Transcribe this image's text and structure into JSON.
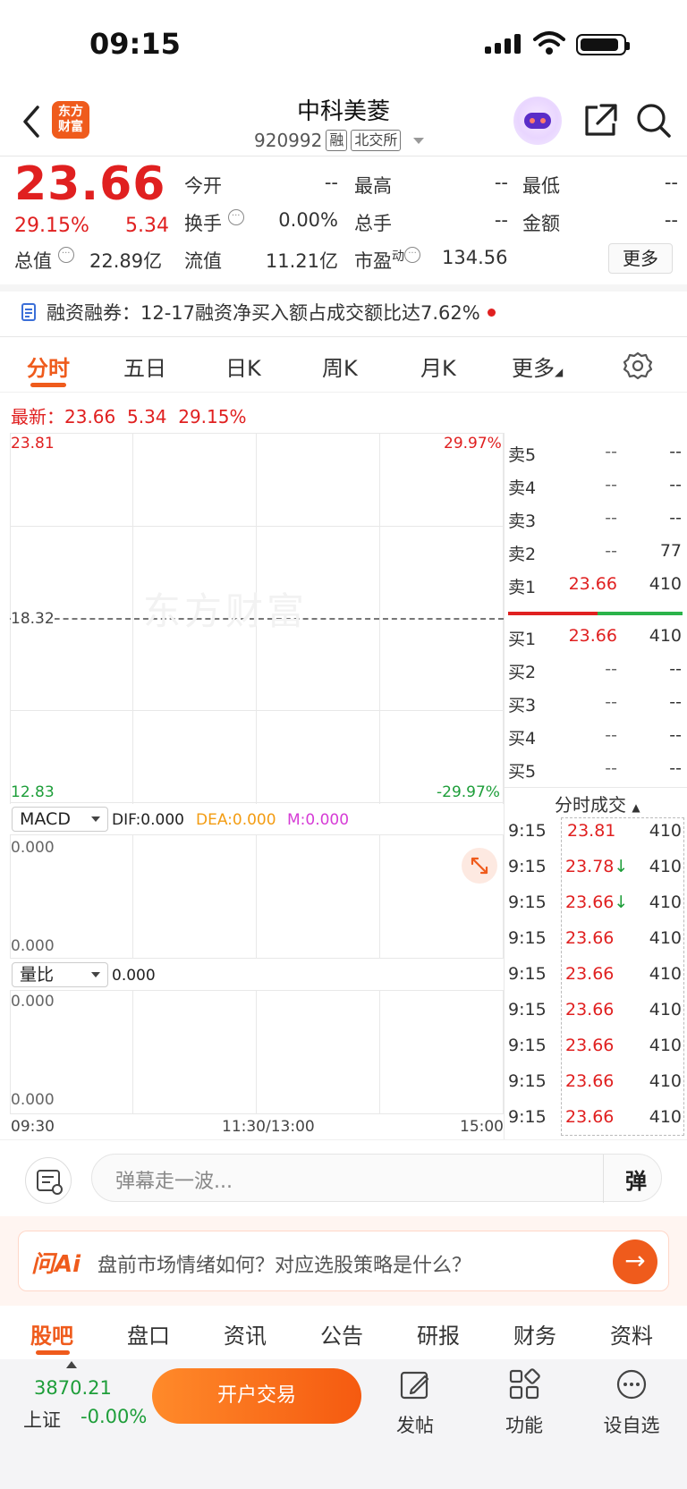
{
  "status": {
    "time": "09:15"
  },
  "header": {
    "logo_line1": "东方",
    "logo_line2": "财富",
    "stock_name": "中科美菱",
    "code": "920992",
    "tag_margin": "融",
    "tag_exchange": "北交所"
  },
  "quote": {
    "price": "23.66",
    "change_pct": "29.15%",
    "change": "5.34",
    "open_label": "今开",
    "open_value": "--",
    "high_label": "最高",
    "high_value": "--",
    "low_label": "最低",
    "low_value": "--",
    "turnover_label": "换手",
    "turnover_value": "0.00%",
    "volume_label": "总手",
    "volume_value": "--",
    "amount_label": "金额",
    "amount_value": "--",
    "mktcap_label": "总值",
    "mktcap_value": "22.89亿",
    "float_label": "流值",
    "float_value": "11.21亿",
    "pe_label": "市盈",
    "pe_sup": "动",
    "pe_value": "134.56",
    "more_label": "更多"
  },
  "notice": {
    "text": "融资融券：12-17融资净买入额占成交额比达7.62%"
  },
  "tabs": [
    "分时",
    "五日",
    "日K",
    "周K",
    "月K",
    "更多"
  ],
  "chart": {
    "latest_label": "最新：",
    "latest_price": "23.66",
    "latest_change": "5.34",
    "latest_pct": "29.15%",
    "y_top": "23.81",
    "y_mid": "18.32",
    "y_bottom": "12.83",
    "pct_top": "29.97%",
    "pct_bottom": "-29.97%",
    "watermark": "东方财富",
    "x_start": "09:30",
    "x_mid": "11:30/13:00",
    "x_end": "15:00"
  },
  "macd": {
    "selector": "MACD",
    "dif": "DIF:0.000",
    "dea": "DEA:0.000",
    "m": "M:0.000",
    "top": "0.000",
    "bottom": "0.000"
  },
  "volume_ratio": {
    "selector": "量比",
    "value": "0.000",
    "top": "0.000",
    "bottom": "0.000"
  },
  "order_book": {
    "asks": [
      {
        "label": "卖5",
        "price": "--",
        "vol": "--"
      },
      {
        "label": "卖4",
        "price": "--",
        "vol": "--"
      },
      {
        "label": "卖3",
        "price": "--",
        "vol": "--"
      },
      {
        "label": "卖2",
        "price": "--",
        "vol": "77"
      },
      {
        "label": "卖1",
        "price": "23.66",
        "vol": "410"
      }
    ],
    "bids": [
      {
        "label": "买1",
        "price": "23.66",
        "vol": "410"
      },
      {
        "label": "买2",
        "price": "--",
        "vol": "--"
      },
      {
        "label": "买3",
        "price": "--",
        "vol": "--"
      },
      {
        "label": "买4",
        "price": "--",
        "vol": "--"
      },
      {
        "label": "买5",
        "price": "--",
        "vol": "--"
      }
    ]
  },
  "trades": {
    "title": "分时成交",
    "rows": [
      {
        "time": "9:15",
        "price": "23.81",
        "arrow": "",
        "vol": "410"
      },
      {
        "time": "9:15",
        "price": "23.78",
        "arrow": "↓",
        "vol": "410"
      },
      {
        "time": "9:15",
        "price": "23.66",
        "arrow": "↓",
        "vol": "410"
      },
      {
        "time": "9:15",
        "price": "23.66",
        "arrow": "",
        "vol": "410"
      },
      {
        "time": "9:15",
        "price": "23.66",
        "arrow": "",
        "vol": "410"
      },
      {
        "time": "9:15",
        "price": "23.66",
        "arrow": "",
        "vol": "410"
      },
      {
        "time": "9:15",
        "price": "23.66",
        "arrow": "",
        "vol": "410"
      },
      {
        "time": "9:15",
        "price": "23.66",
        "arrow": "",
        "vol": "410"
      },
      {
        "time": "9:15",
        "price": "23.66",
        "arrow": "",
        "vol": "410"
      }
    ]
  },
  "comment": {
    "placeholder": "弹幕走一波...",
    "danmu": "弹"
  },
  "ai": {
    "logo": "问Ai",
    "prompt": "盘前市场情绪如何？对应选股策略是什么？"
  },
  "sections": [
    "股吧",
    "盘口",
    "资讯",
    "公告",
    "研报",
    "财务",
    "资料"
  ],
  "bottom": {
    "index_value": "3870.21",
    "index_name": "上证",
    "index_pct": "-0.00%",
    "trade_button": "开户交易",
    "post": "发帖",
    "functions": "功能",
    "watchlist": "设自选"
  },
  "colors": {
    "accent": "#ef5b1c",
    "up": "#e02020",
    "down": "#1e9e3a"
  }
}
